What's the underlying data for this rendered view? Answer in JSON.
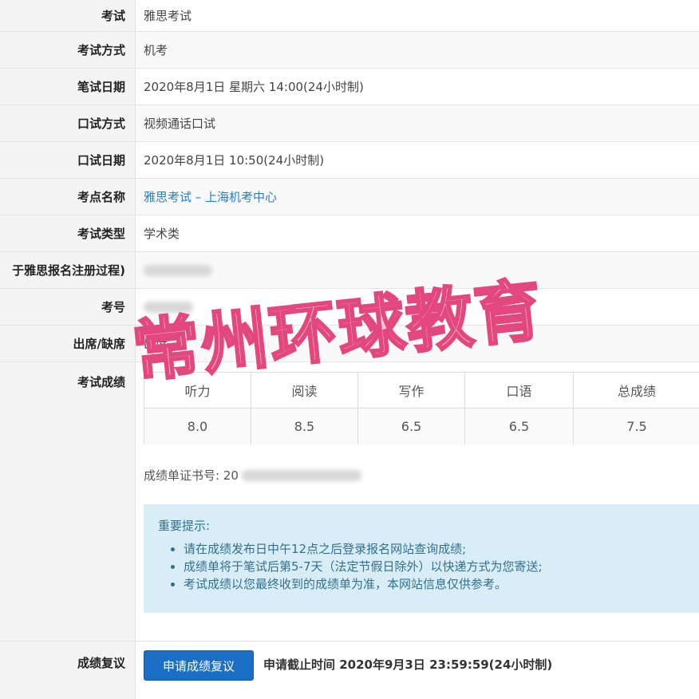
{
  "rows": [
    {
      "label": "考试",
      "value": "雅思考试"
    },
    {
      "label": "考试方式",
      "value": "机考"
    },
    {
      "label": "笔试日期",
      "value": "2020年8月1日 星期六 14:00(24小时制)"
    },
    {
      "label": "口试方式",
      "value": "视频通话口试"
    },
    {
      "label": "口试日期",
      "value": "2020年8月1日 10:50(24小时制)"
    },
    {
      "label": "考点名称",
      "value": "雅思考试 – 上海机考中心"
    },
    {
      "label": "考试类型",
      "value": "学术类"
    },
    {
      "label": "于雅思报名注册过程)",
      "value": ""
    },
    {
      "label": "考号",
      "value": ""
    },
    {
      "label": "出席/缺席",
      "value": "出席"
    }
  ],
  "scores_label": "考试成绩",
  "scores": {
    "headers": [
      "听力",
      "阅读",
      "写作",
      "口语",
      "总成绩"
    ],
    "values": [
      "8.0",
      "8.5",
      "6.5",
      "6.5",
      "7.5"
    ]
  },
  "certificate": {
    "label": "成绩单证书号:",
    "value_prefix": "20"
  },
  "notice": {
    "title": "重要提示:",
    "items": [
      "请在成绩发布日中午12点之后登录报名网站查询成绩;",
      "成绩单将于笔试后第5-7天（法定节假日除外）以快递方式为您寄送;",
      "考试成绩以您最终收到的成绩单为准，本网站信息仅供参考。"
    ]
  },
  "review": {
    "label": "成绩复议",
    "button": "申请成绩复议",
    "deadline": "申请截止时间 2020年9月3日 23:59:59(24小时制)"
  },
  "watermark": "常州环球教育",
  "colors": {
    "link": "#2a7fb8",
    "notice_bg": "#d9edf7",
    "notice_text": "#31708f",
    "button": "#1a6fc4",
    "watermark_stroke": "#e2477d"
  }
}
